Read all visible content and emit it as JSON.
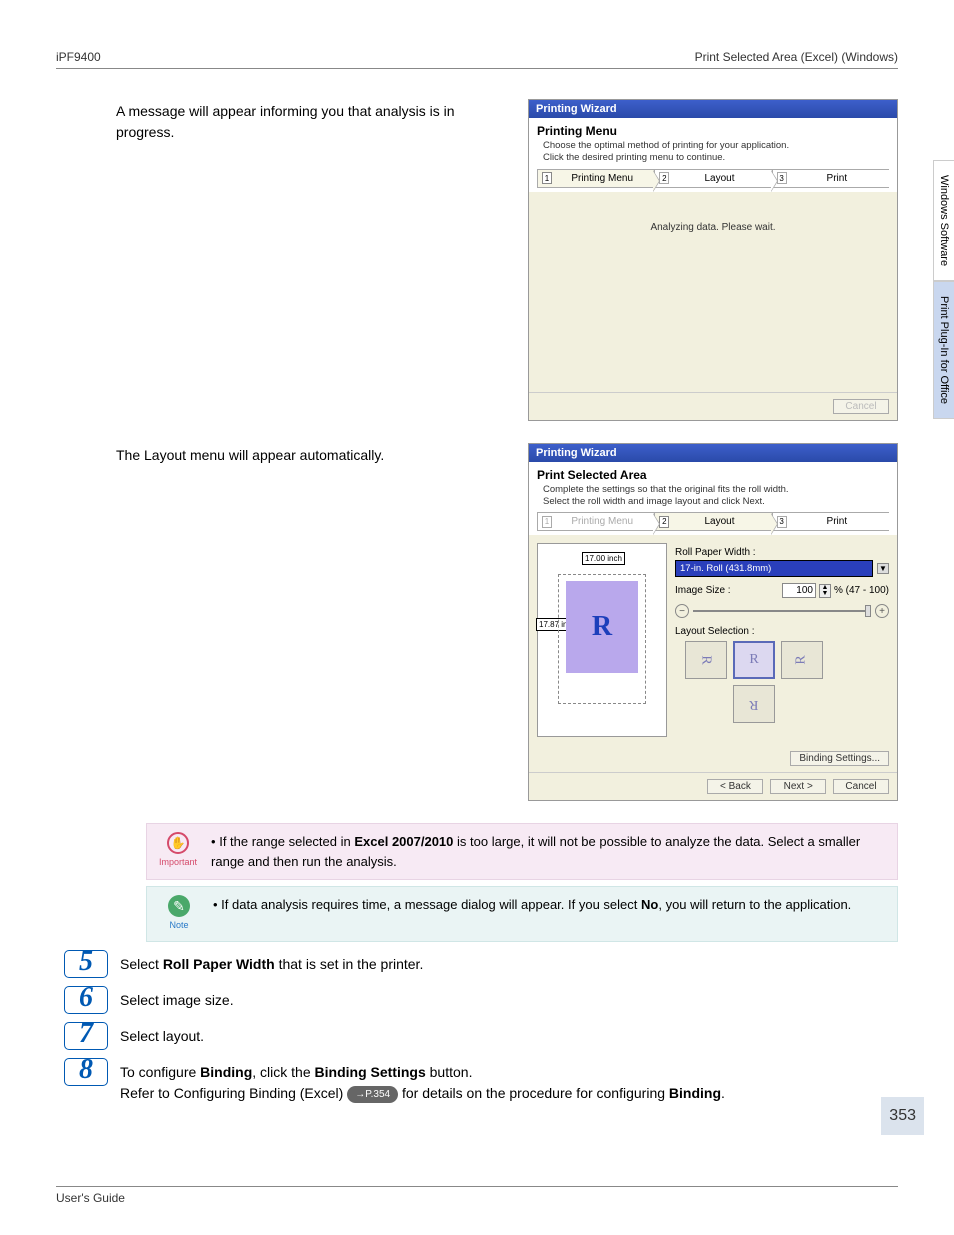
{
  "header": {
    "left": "iPF9400",
    "right": "Print Selected Area (Excel) (Windows)"
  },
  "side_tabs": [
    "Windows Software",
    "Print Plug-In for Office"
  ],
  "row1_text": "A message will appear informing you that analysis is in progress.",
  "wizard1": {
    "title": "Printing Wizard",
    "heading": "Printing Menu",
    "desc1": "Choose the optimal method of printing for your application.",
    "desc2": "Click the desired printing menu to continue.",
    "tab1": "Printing Menu",
    "tab2": "Layout",
    "tab3": "Print",
    "body": "Analyzing data. Please wait.",
    "cancel": "Cancel"
  },
  "row2_text": "The Layout menu will appear automatically.",
  "wizard2": {
    "title": "Printing Wizard",
    "heading": "Print Selected Area",
    "desc1": "Complete the settings so that the original fits the roll width.",
    "desc2": "Select the roll width and image layout and click Next.",
    "tab1": "Printing Menu",
    "tab2": "Layout",
    "tab3": "Print",
    "dim_top": "17.00 inch",
    "dim_left": "17.87 inch",
    "preview_glyph": "R",
    "roll_label": "Roll Paper Width :",
    "roll_value": "17-in. Roll (431.8mm)",
    "image_size_label": "Image Size :",
    "image_size_value": "100",
    "image_size_range": "% (47 - 100)",
    "layout_sel_label": "Layout Selection :",
    "binding_btn": "Binding Settings...",
    "back": "< Back",
    "next": "Next >",
    "cancel": "Cancel"
  },
  "important": {
    "label": "Important",
    "bullet_pre": "If the range selected in ",
    "bullet_bold": "Excel 2007/2010",
    "bullet_post": " is too large, it will not be possible to analyze the data. Select a smaller range and then run the analysis."
  },
  "note": {
    "label": "Note",
    "bullet_pre": "If data analysis requires time, a message dialog will appear. If you select ",
    "bullet_bold": "No",
    "bullet_post": ", you will return to the application."
  },
  "steps": {
    "s5": {
      "n": "5",
      "pre": "Select ",
      "bold": "Roll Paper Width",
      "post": " that is set in the printer."
    },
    "s6": {
      "n": "6",
      "text": "Select image size."
    },
    "s7": {
      "n": "7",
      "text": "Select layout."
    },
    "s8": {
      "n": "8",
      "l1_pre": "To configure ",
      "l1_b1": "Binding",
      "l1_mid": ", click the ",
      "l1_b2": "Binding Settings",
      "l1_post": " button.",
      "l2_pre": "Refer to Configuring Binding (Excel) ",
      "l2_ref": "→P.354",
      "l2_mid": " for details on the procedure for configuring ",
      "l2_bold": "Binding",
      "l2_post": "."
    }
  },
  "page_number": "353",
  "footer": "User's Guide"
}
